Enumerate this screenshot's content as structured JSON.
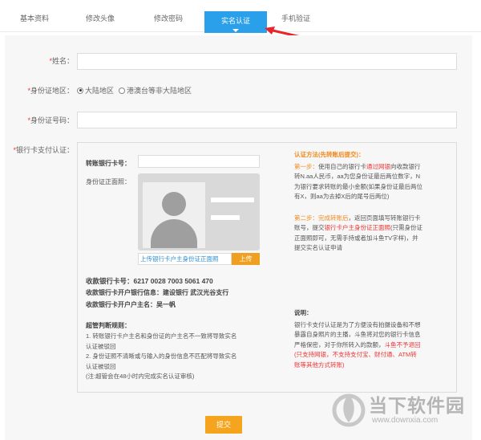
{
  "tabs": [
    {
      "label": "基本资料"
    },
    {
      "label": "修改头像"
    },
    {
      "label": "修改密码"
    },
    {
      "label": "实名认证"
    },
    {
      "label": "手机验证"
    }
  ],
  "form": {
    "required_mark": "*",
    "name_label": "姓名：",
    "name_value": "",
    "region_label": "身份证地区：",
    "region_options": [
      "大陆地区",
      "港澳台等非大陆地区"
    ],
    "id_number_label": "身份证号码：",
    "id_number_value": "",
    "bank_auth_label": "银行卡支付认证："
  },
  "bank_panel": {
    "transfer_card_label": "转账银行卡号：",
    "transfer_card_value": "",
    "id_front_label": "身份证正面照：",
    "upload_placeholder": "上传银行卡户主身份证正面照",
    "upload_button": "上传",
    "receive_card": "收款银行卡号：6217 0028 7003 5061 470",
    "receive_bank": "收款银行卡开户银行信息：建设银行 武汉光谷支行",
    "receive_owner": "收款银行卡开户户主名：吴一帆",
    "rules_title": "超管判断规则：",
    "rules": [
      "1. 转账银行卡户主名和身份证的户主名不一致将导致实名",
      "认证被驳回",
      "2. 身份证照不清晰或与输入的身份信息不匹配将导致实名",
      "认证被驳回",
      "(注:超管会在48小时内完成实名认证审核)"
    ]
  },
  "instructions": {
    "method_title": "认证方法(先转账后提交)：",
    "step1_prefix": "第一步：",
    "step1_a": "使用自己的银行卡",
    "step1_link": "通过网银",
    "step1_b": "向收款银行",
    "step1_lines": [
      "转N.aa人民币，aa为您身份证最后两位数字，N",
      "为银行要求转账的最小金额(如果身份证最后两位",
      "有X，则aa为去掉X后的尾号后两位)"
    ],
    "step2_prefix": "第二步：",
    "step2_a": "完成转账后",
    "step2_b": "，返回页面填写转账银行卡",
    "step2_c": "账号，提交",
    "step2_link": "银行卡户主身份证正面照",
    "step2_d": "(只需身份证",
    "step2_lines": [
      "正面照即可，无需手持或者加斗鱼TV字样)，并",
      "提交实名认证申请"
    ],
    "note_title": "说明：",
    "note_lines": [
      "银行卡支付认证是为了方便没有拍摄设备和不想",
      "暴露自身照片的主播，斗鱼将对您的银行卡信息",
      "严格保密，对于你所转入的款额，"
    ],
    "note_refund": "斗鱼不予退回",
    "note_red_lines": [
      "(只支持网银，不支持支付宝、财付通、ATM转",
      "账等其他方式转账)"
    ]
  },
  "submit_label": "提交",
  "watermark": {
    "title": "当下软件园",
    "url": "www.downxia.com"
  },
  "colors": {
    "active_tab": "#2aa0ea",
    "accent_orange": "#f5a41e",
    "link_blue": "#2a8fd6",
    "required_red": "#e33333",
    "annotation_arrow": "#e8252a"
  }
}
